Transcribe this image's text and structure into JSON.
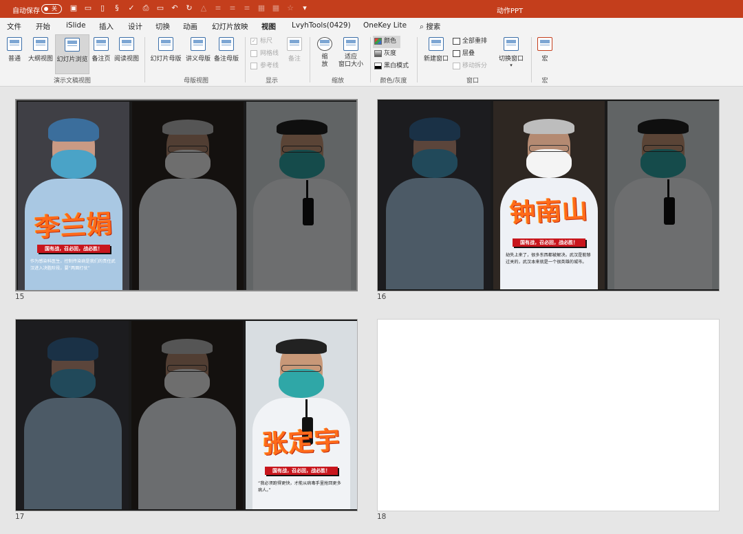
{
  "titlebar": {
    "autosave_label": "自动保存",
    "autosave_state": "关",
    "document_title": "动作PPT",
    "quick_access_icons": [
      "save-icon",
      "open-icon",
      "new-icon",
      "format-painter-icon",
      "spellcheck-icon",
      "print-preview-icon",
      "present-icon",
      "undo-icon",
      "redo-icon",
      "shape-icon",
      "align-left-icon",
      "align-center-icon",
      "align-right-icon",
      "distribute-icon",
      "grid-icon",
      "star-icon",
      "customize-icon"
    ]
  },
  "tabs": [
    "文件",
    "开始",
    "iSlide",
    "插入",
    "设计",
    "切换",
    "动画",
    "幻灯片放映",
    "视图",
    "LvyhTools(0429)",
    "OneKey Lite",
    "搜索"
  ],
  "active_tab": "视图",
  "ribbon": {
    "presentation_views": {
      "label": "演示文稿视图",
      "buttons": [
        "普通",
        "大纲视图",
        "幻灯片浏览",
        "备注页",
        "阅读视图"
      ],
      "selected": "幻灯片浏览"
    },
    "master_views": {
      "label": "母版视图",
      "buttons": [
        "幻灯片母版",
        "讲义母版",
        "备注母版"
      ]
    },
    "show": {
      "label": "显示",
      "checkboxes": [
        {
          "label": "标尺",
          "checked": true
        },
        {
          "label": "网格线",
          "checked": false
        },
        {
          "label": "参考线",
          "checked": false
        }
      ],
      "notes_button": "备注"
    },
    "zoom": {
      "label": "缩放",
      "zoom_button": "缩\n放",
      "fit_button": "适应\n窗口大小"
    },
    "color": {
      "label": "颜色/灰度",
      "options": [
        "颜色",
        "灰度",
        "黑白模式"
      ],
      "selected": "颜色"
    },
    "window": {
      "label": "窗口",
      "new_window": "新建窗口",
      "arrange_all": "全部重排",
      "cascade": "层叠",
      "move_split": "移动拆分",
      "switch_windows": "切换窗口"
    },
    "macros": {
      "label": "宏",
      "button": "宏"
    }
  },
  "slides": [
    {
      "number": "15",
      "highlight_panel": 0,
      "name": "李兰娟",
      "slogan": "国有战，召必回，战必胜！",
      "quote": "作为感染科医生，控制传染病是我们的责任武汉进入决胜阶段，要“两面打仗”"
    },
    {
      "number": "16",
      "highlight_panel": 1,
      "name": "钟南山",
      "slogan": "国有战，召必回，战必胜！",
      "quote": "劫失上来了，很多东西都被解决。武汉是能够过关的，武汉本来就是一个很英雄的城市。"
    },
    {
      "number": "17",
      "highlight_panel": 2,
      "name": "张定宇",
      "slogan": "国有战，召必回，战必胜！",
      "quote": "“我必须跑得更快，才能从病毒手里抢回更多病人。”"
    },
    {
      "number": "18",
      "blank": true
    }
  ],
  "colors": {
    "titlebar": "#c43e1c",
    "name_orange": "#ff6a1a",
    "slogan_red": "#c8161d"
  }
}
